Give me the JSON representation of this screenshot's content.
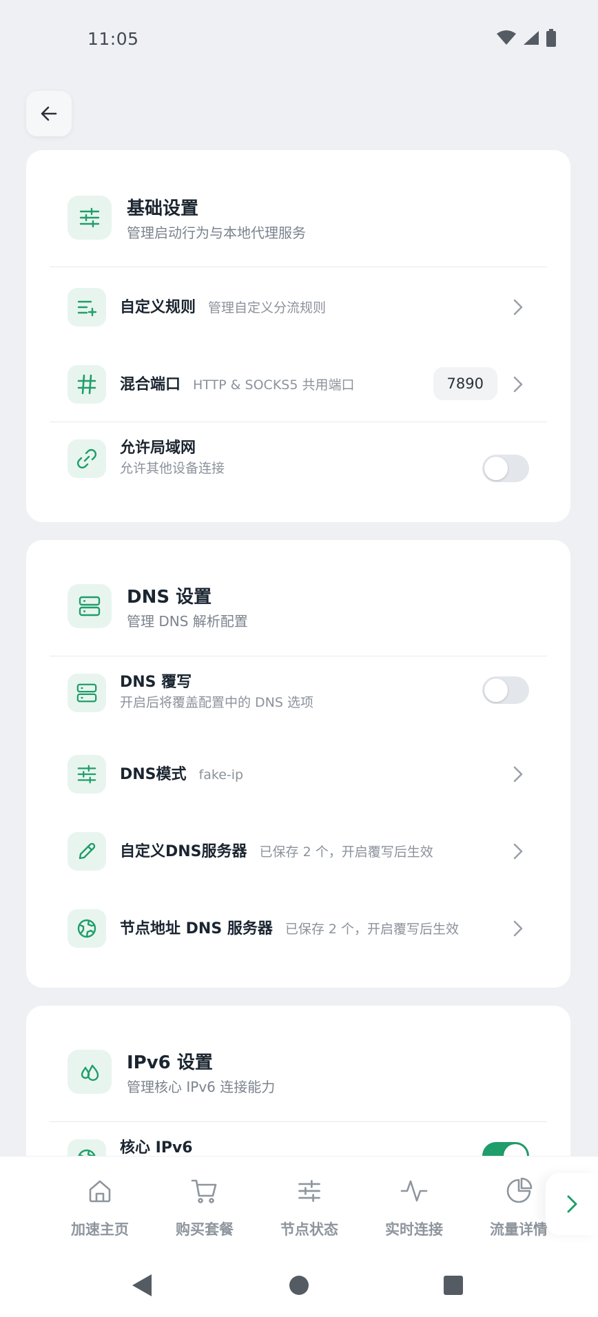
{
  "status_bar": {
    "time": "11:05"
  },
  "basic": {
    "title": "基础设置",
    "subtitle": "管理启动行为与本地代理服务",
    "rows": [
      {
        "title": "自定义规则",
        "sub": "管理自定义分流规则"
      },
      {
        "title": "混合端口",
        "sub": "HTTP & SOCKS5 共用端口",
        "value": "7890"
      },
      {
        "title": "允许局域网",
        "sub": "允许其他设备连接",
        "toggle": false
      }
    ]
  },
  "dns": {
    "title": "DNS 设置",
    "subtitle": "管理 DNS 解析配置",
    "rows": [
      {
        "title": "DNS 覆写",
        "sub": "开启后将覆盖配置中的 DNS 选项",
        "toggle": false
      },
      {
        "title": "DNS模式",
        "sub": "fake-ip"
      },
      {
        "title": "自定义DNS服务器",
        "sub": "已保存 2 个，开启覆写后生效"
      },
      {
        "title": "节点地址 DNS 服务器",
        "sub": "已保存 2 个，开启覆写后生效"
      }
    ]
  },
  "ipv6": {
    "title": "IPv6 设置",
    "subtitle": "管理核心 IPv6 连接能力",
    "rows": [
      {
        "title": "核心 IPv6",
        "toggle": true
      }
    ]
  },
  "bottom_nav": {
    "items": [
      {
        "label": "加速主页",
        "icon": "home-icon"
      },
      {
        "label": "购买套餐",
        "icon": "cart-icon"
      },
      {
        "label": "节点状态",
        "icon": "sliders-icon"
      },
      {
        "label": "实时连接",
        "icon": "activity-icon"
      },
      {
        "label": "流量详情",
        "icon": "pie-chart-icon"
      }
    ]
  },
  "colors": {
    "accent": "#1f9d6a",
    "icon_bg": "#e8f5ee",
    "page_bg": "#eef0f3"
  }
}
